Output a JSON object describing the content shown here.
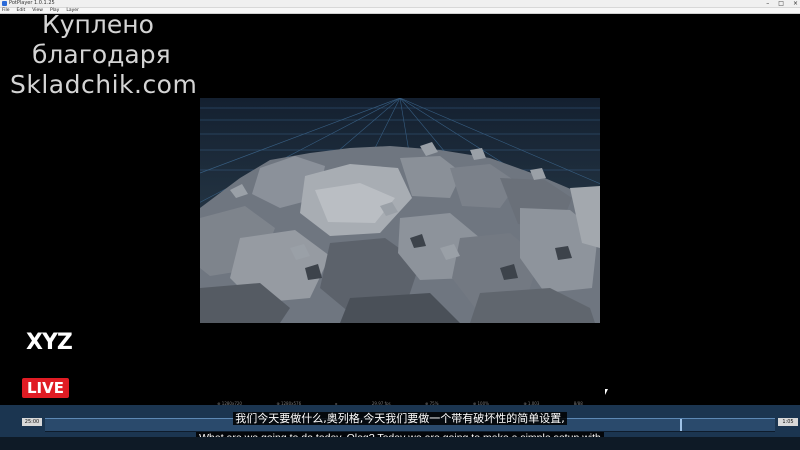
{
  "window": {
    "title": "PotPlayer 1.0.1.25"
  },
  "menu": {
    "items": [
      "File",
      "Edit",
      "View",
      "Play",
      "Layer"
    ]
  },
  "watermark": {
    "line1": "Куплено",
    "line2": "благодаря",
    "line3": "Skladchik.com"
  },
  "logo": {
    "brand": "XYZ",
    "badge": "LIVE"
  },
  "statusbar": {
    "items": [
      "⊕ 1280x720",
      "⊕ 1280x576",
      "▸",
      "29.97 fps",
      "⊕ 75%",
      "⊕ 100%",
      "⊕ 1.003",
      "8/88"
    ]
  },
  "timeline": {
    "start_time": "25:00",
    "end_time": "1:05",
    "playhead_fraction": 0.87
  },
  "subtitles": {
    "chinese": "我们今天要做什么,奥列格,今天我们要做一个带有破坏性的简单设置,",
    "english": "What are we going to do today. Oleg? Today we are going to make a simple setup with"
  },
  "colors": {
    "accent_live": "#e01c24",
    "timeline_bg": "#1b3550"
  }
}
